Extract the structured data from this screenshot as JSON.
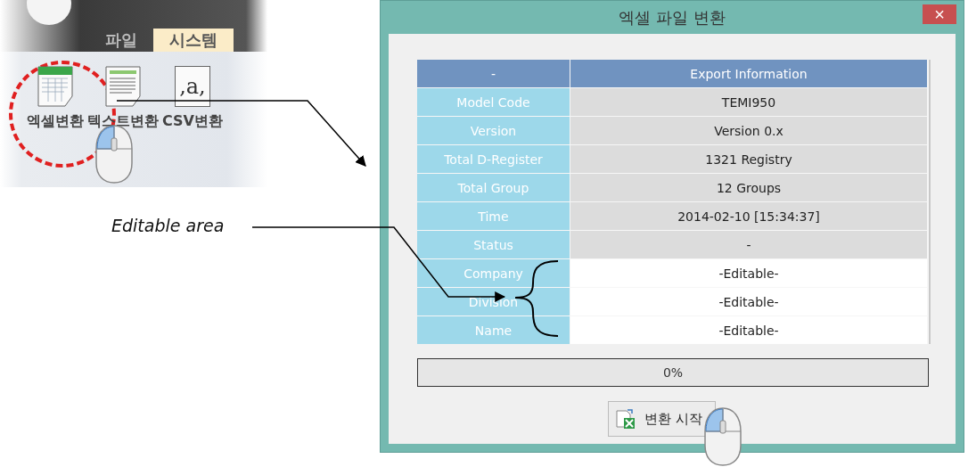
{
  "ribbon": {
    "tabs": [
      {
        "label": "파일",
        "selected": false
      },
      {
        "label": "시스템",
        "selected": true
      }
    ],
    "buttons": [
      {
        "label": "엑셀변환",
        "kind": "sheet",
        "marked": true
      },
      {
        "label": "텍스트변환",
        "kind": "text",
        "marked": false
      },
      {
        "label": "CSV변환",
        "kind": "glyph",
        "glyph": ",a,",
        "marked": false
      }
    ]
  },
  "annotation": {
    "label": "Editable area"
  },
  "dialog": {
    "title": "엑셀 파일 변환",
    "close": "×",
    "table": {
      "columns": [
        "-",
        "Export Information"
      ],
      "rows": [
        {
          "label": "Model Code",
          "value": "TEMI950",
          "editable": false
        },
        {
          "label": "Version",
          "value": "Version 0.x",
          "editable": false
        },
        {
          "label": "Total D-Register",
          "value": "1321 Registry",
          "editable": false
        },
        {
          "label": "Total Group",
          "value": "12 Groups",
          "editable": false
        },
        {
          "label": "Time",
          "value": "2014-02-10 [15:34:37]",
          "editable": false
        },
        {
          "label": "Status",
          "value": "-",
          "editable": false
        },
        {
          "label": "Company",
          "value": "-Editable-",
          "editable": true
        },
        {
          "label": "Division",
          "value": "-Editable-",
          "editable": true
        },
        {
          "label": "Name",
          "value": "-Editable-",
          "editable": true
        }
      ]
    },
    "progress": {
      "text": "0%",
      "level": 0
    },
    "button": {
      "label": "변환 시작"
    }
  }
}
